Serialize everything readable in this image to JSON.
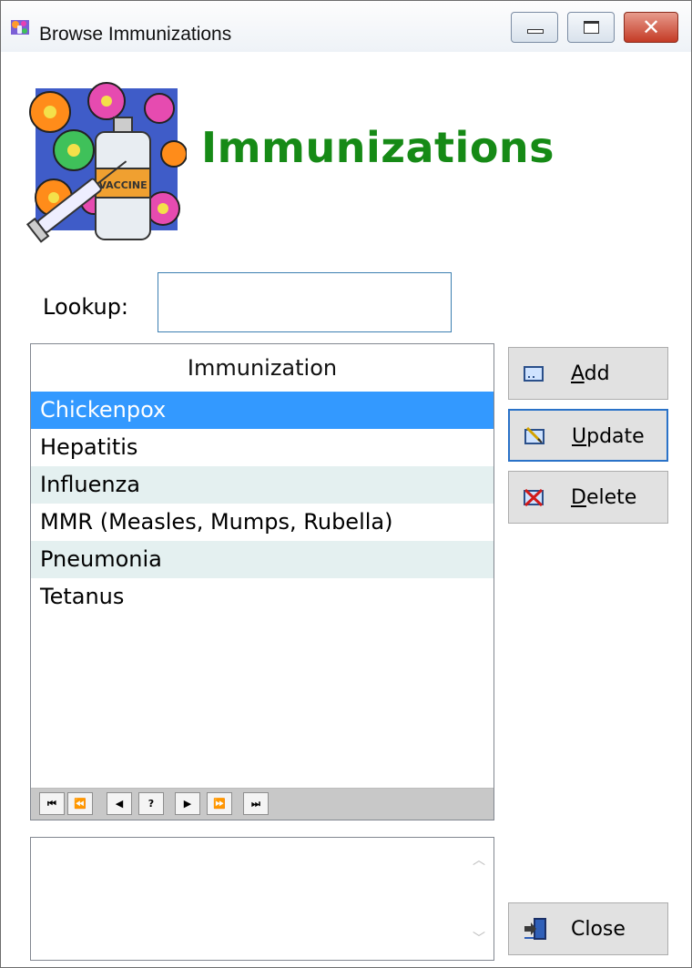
{
  "window": {
    "title": "Browse Immunizations",
    "close_glyph": "✕"
  },
  "header": {
    "heading": "Immunizations"
  },
  "lookup": {
    "label": "Lookup:",
    "value": ""
  },
  "grid": {
    "column_header": "Immunization",
    "rows": [
      {
        "label": "Chickenpox",
        "state": "selected"
      },
      {
        "label": "Hepatitis",
        "state": "normal"
      },
      {
        "label": "Influenza",
        "state": "alt"
      },
      {
        "label": "MMR (Measles, Mumps, Rubella)",
        "state": "normal"
      },
      {
        "label": "Pneumonia",
        "state": "alt"
      },
      {
        "label": "Tetanus",
        "state": "normal"
      }
    ],
    "nav": [
      "⏮",
      "⏪",
      "◀",
      "?",
      "▶",
      "⏩",
      "⏭"
    ]
  },
  "buttons": {
    "add": {
      "accel": "A",
      "rest": "dd",
      "icon": "add-icon"
    },
    "update": {
      "accel": "U",
      "rest": "pdate",
      "icon": "update-icon"
    },
    "delete": {
      "accel": "D",
      "rest": "elete",
      "icon": "delete-icon"
    },
    "close": {
      "label": "Close",
      "icon": "exit-door-icon"
    }
  },
  "memo": {
    "text": ""
  },
  "colors": {
    "heading": "#168a16",
    "selection": "#3399ff",
    "alt_row": "#e4f0f0",
    "focus_border": "#2a72c8"
  }
}
